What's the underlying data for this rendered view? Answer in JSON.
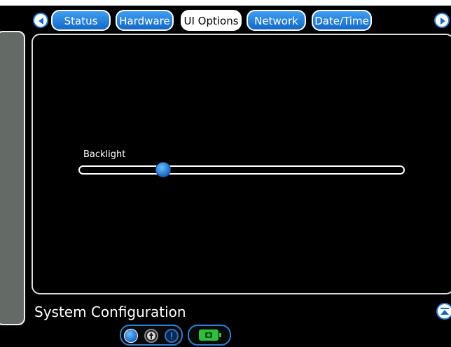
{
  "tabs": [
    {
      "label": "Status",
      "active": false
    },
    {
      "label": "Hardware",
      "active": false
    },
    {
      "label": "UI Options",
      "active": true
    },
    {
      "label": "Network",
      "active": false
    },
    {
      "label": "Date/Time",
      "active": false
    }
  ],
  "settings": {
    "backlight_label": "Backlight",
    "backlight_level": 0.26
  },
  "page": {
    "title": "System Configuration"
  },
  "icons": {
    "prev": "chevron-left-icon",
    "next": "chevron-right-icon",
    "scroll_up": "scroll-up-icon",
    "status": [
      "status-active-icon",
      "info-icon",
      "alert-icon"
    ],
    "battery": "battery-icon"
  },
  "colors": {
    "accent": "#2a7fd6",
    "tab_gradient_top": "#3f9ff0",
    "tab_gradient_bottom": "#1468c6",
    "battery_fill": "#2fbf3c"
  }
}
